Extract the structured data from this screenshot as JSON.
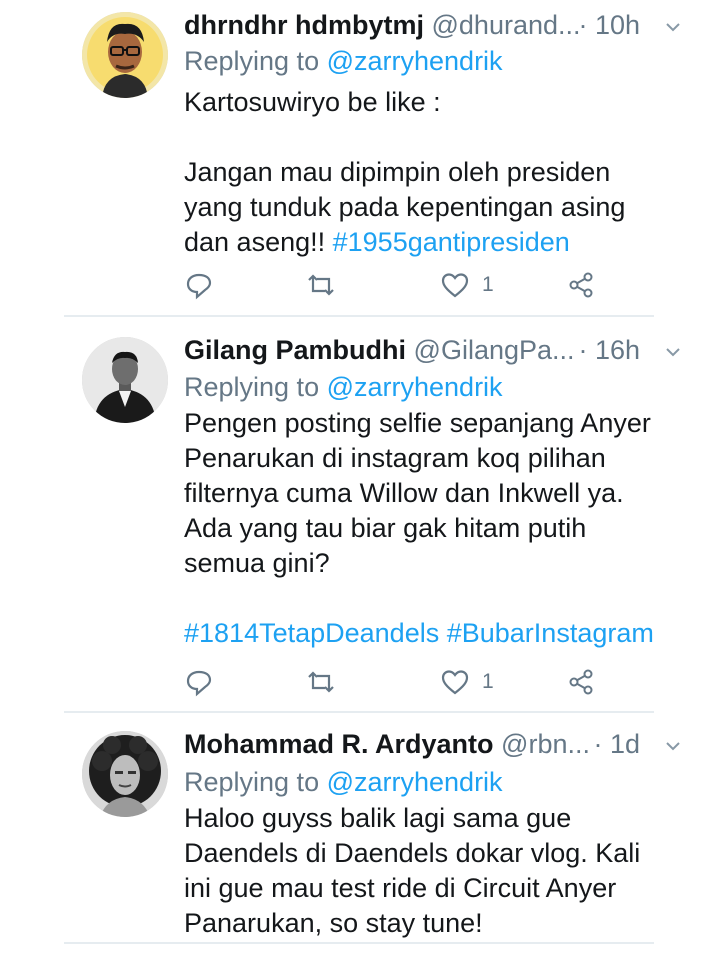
{
  "tweets": [
    {
      "name": "dhrndhr hdmbytmj",
      "handle": "@dhurand...",
      "time": "· 10h",
      "replying_prefix": "Replying to ",
      "replying_to": "@zarryhendrik",
      "lines": [
        "Kartosuwiryo be like :",
        "",
        "Jangan mau dipimpin oleh presiden",
        "yang tunduk pada kepentingan asing"
      ],
      "last_line_text": "dan aseng!! ",
      "last_line_tag": "#1955gantipresiden",
      "likes": "1",
      "avatar_icon": "person-glasses-avatar"
    },
    {
      "name": "Gilang Pambudhi",
      "handle": "@GilangPa...",
      "time": "· 16h",
      "replying_prefix": "Replying to ",
      "replying_to": "@zarryhendrik",
      "lines": [
        "Pengen posting selfie sepanjang Anyer",
        "Penarukan di instagram koq pilihan",
        "filternya cuma Willow dan Inkwell ya.",
        "Ada yang tau biar gak hitam putih",
        "semua gini?",
        ""
      ],
      "tag_line": [
        "#1814TetapDeandels",
        "#BubarInstagram"
      ],
      "likes": "1",
      "avatar_icon": "person-suit-avatar"
    },
    {
      "name": "Mohammad R. Ardyanto",
      "handle": "@rbn...",
      "time": "· 1d",
      "replying_prefix": "Replying to ",
      "replying_to": "@zarryhendrik",
      "lines": [
        "Haloo guyss balik lagi sama gue",
        "Daendels di Daendels dokar vlog. Kali",
        "ini gue mau test ride di Circuit Anyer",
        "Panarukan, so stay tune!"
      ],
      "avatar_icon": "person-curly-hair-avatar"
    }
  ],
  "colors": {
    "accent": "#1da1f2",
    "muted": "#657786",
    "text": "#14171a",
    "divider": "#e6ecf0"
  },
  "icons": [
    "reply-icon",
    "retweet-icon",
    "like-icon",
    "share-icon",
    "chevron-down-icon"
  ]
}
